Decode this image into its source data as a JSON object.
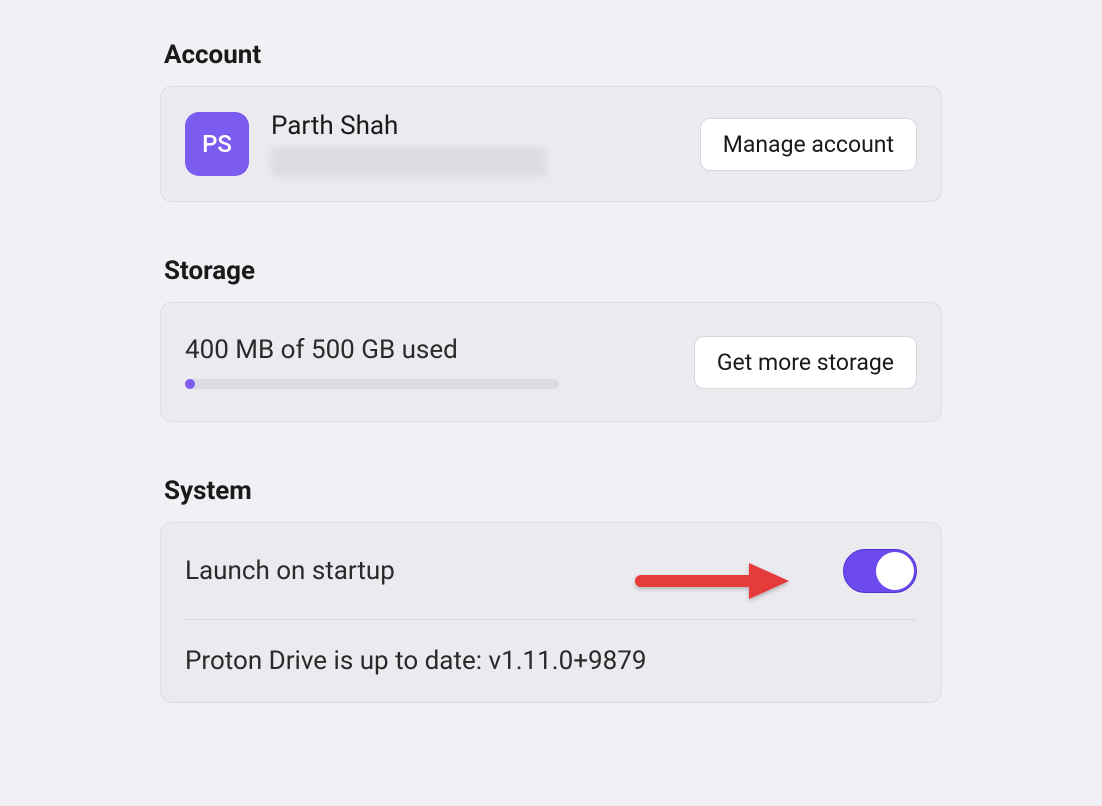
{
  "account": {
    "section_title": "Account",
    "avatar_initials": "PS",
    "name": "Parth Shah",
    "manage_button_label": "Manage account"
  },
  "storage": {
    "section_title": "Storage",
    "usage_text": "400 MB of 500 GB used",
    "get_more_button_label": "Get more storage",
    "progress_percent": 2
  },
  "system": {
    "section_title": "System",
    "launch_on_startup_label": "Launch on startup",
    "launch_on_startup_enabled": true,
    "update_status": "Proton Drive is up to date: v1.11.0+9879"
  },
  "colors": {
    "accent": "#7b5bf0",
    "card_bg": "#ebeaef",
    "page_bg": "#f1f0f5",
    "annotation": "#e63946"
  }
}
